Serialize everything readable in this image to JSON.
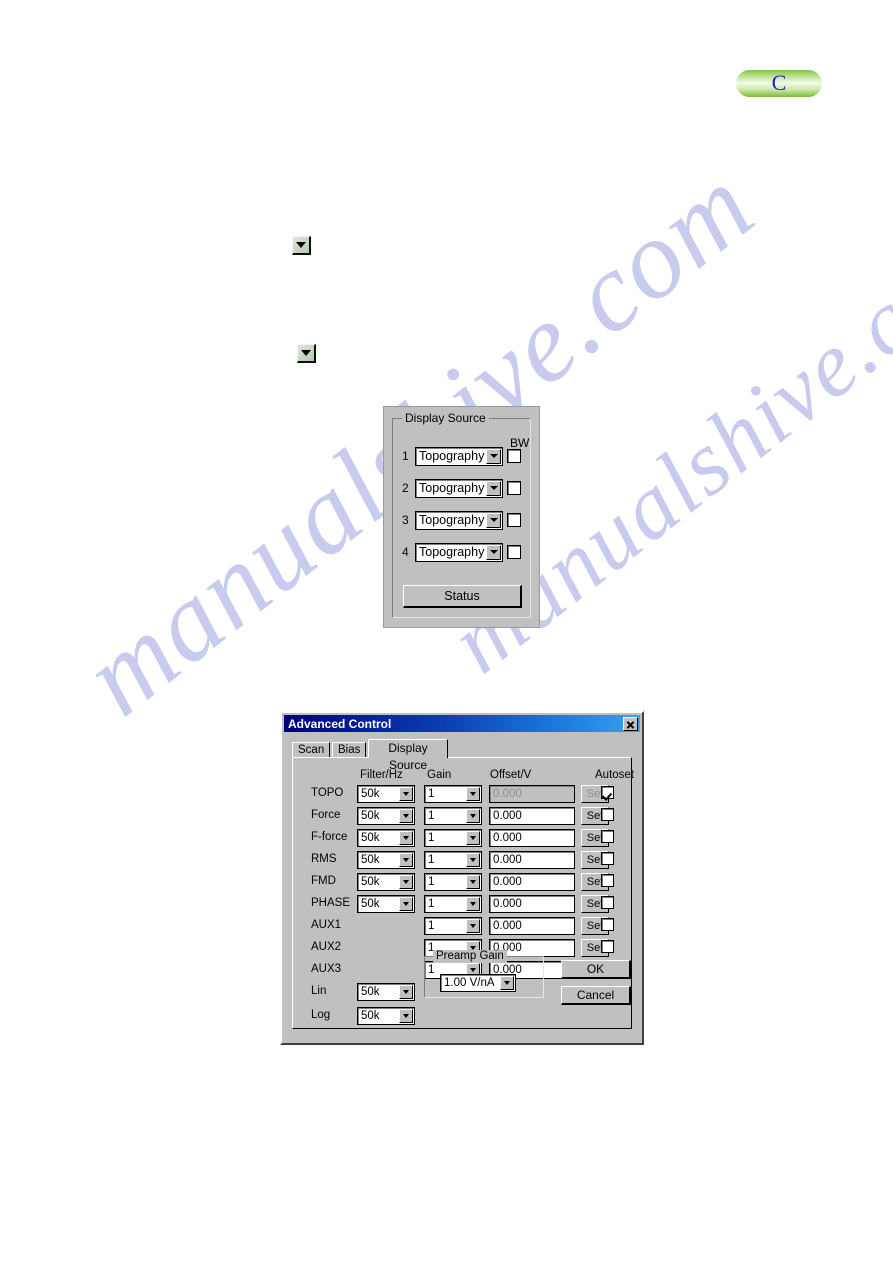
{
  "page": {
    "background": "#ffffff",
    "watermark": {
      "line1": "manualshive.com",
      "line2": "manualshive.com",
      "color": "#c9cbee"
    }
  },
  "badge": {
    "letter": "C",
    "pill_color": "#8ecb55",
    "letter_color": "#2222c8"
  },
  "inline_buttons": [
    {
      "name": "dropdown-arrow-button-1",
      "glyph": "chevron-down-icon"
    },
    {
      "name": "dropdown-arrow-button-2",
      "glyph": "chevron-down-icon"
    }
  ],
  "display_source_panel": {
    "group_title": "Display Source",
    "bw_label": "BW",
    "rows": [
      {
        "index": "1",
        "source": "Topography",
        "bw_checked": false
      },
      {
        "index": "2",
        "source": "Topography",
        "bw_checked": false
      },
      {
        "index": "3",
        "source": "Topography",
        "bw_checked": false
      },
      {
        "index": "4",
        "source": "Topography",
        "bw_checked": false
      }
    ],
    "status_button": "Status"
  },
  "advanced_control": {
    "title": "Advanced Control",
    "close_label": "×",
    "tabs": [
      {
        "label": "Scan",
        "selected": false
      },
      {
        "label": "Bias",
        "selected": false
      },
      {
        "label": "Display Source",
        "selected": true
      }
    ],
    "columns": {
      "filter": "Filter/Hz",
      "gain": "Gain",
      "offset": "Offset/V",
      "autoset": "Autoset"
    },
    "set_button_label": "Set",
    "rows": [
      {
        "label": "TOPO",
        "filter": "50k",
        "gain": "1",
        "offset": "0.000",
        "offset_enabled": false,
        "set_enabled": false,
        "autoset": true
      },
      {
        "label": "Force",
        "filter": "50k",
        "gain": "1",
        "offset": "0.000",
        "offset_enabled": true,
        "set_enabled": true,
        "autoset": false
      },
      {
        "label": "F-force",
        "filter": "50k",
        "gain": "1",
        "offset": "0.000",
        "offset_enabled": true,
        "set_enabled": true,
        "autoset": false
      },
      {
        "label": "RMS",
        "filter": "50k",
        "gain": "1",
        "offset": "0.000",
        "offset_enabled": true,
        "set_enabled": true,
        "autoset": false
      },
      {
        "label": "FMD",
        "filter": "50k",
        "gain": "1",
        "offset": "0.000",
        "offset_enabled": true,
        "set_enabled": true,
        "autoset": false
      },
      {
        "label": "PHASE",
        "filter": "50k",
        "gain": "1",
        "offset": "0.000",
        "offset_enabled": true,
        "set_enabled": true,
        "autoset": false
      },
      {
        "label": "AUX1",
        "filter": null,
        "gain": "1",
        "offset": "0.000",
        "offset_enabled": true,
        "set_enabled": true,
        "autoset": false
      },
      {
        "label": "AUX2",
        "filter": null,
        "gain": "1",
        "offset": "0.000",
        "offset_enabled": true,
        "set_enabled": true,
        "autoset": false
      },
      {
        "label": "AUX3",
        "filter": null,
        "gain": "1",
        "offset": "0.000",
        "offset_enabled": true,
        "set_enabled": true,
        "autoset": false
      },
      {
        "label": "Lin",
        "filter": "50k",
        "gain": null,
        "offset": null,
        "offset_enabled": false,
        "set_enabled": false,
        "autoset": null
      },
      {
        "label": "Log",
        "filter": "50k",
        "gain": null,
        "offset": null,
        "offset_enabled": false,
        "set_enabled": false,
        "autoset": null
      }
    ],
    "preamp": {
      "title": "Preamp Gain",
      "value": "1.00 V/nA"
    },
    "ok_label": "OK",
    "cancel_label": "Cancel"
  }
}
